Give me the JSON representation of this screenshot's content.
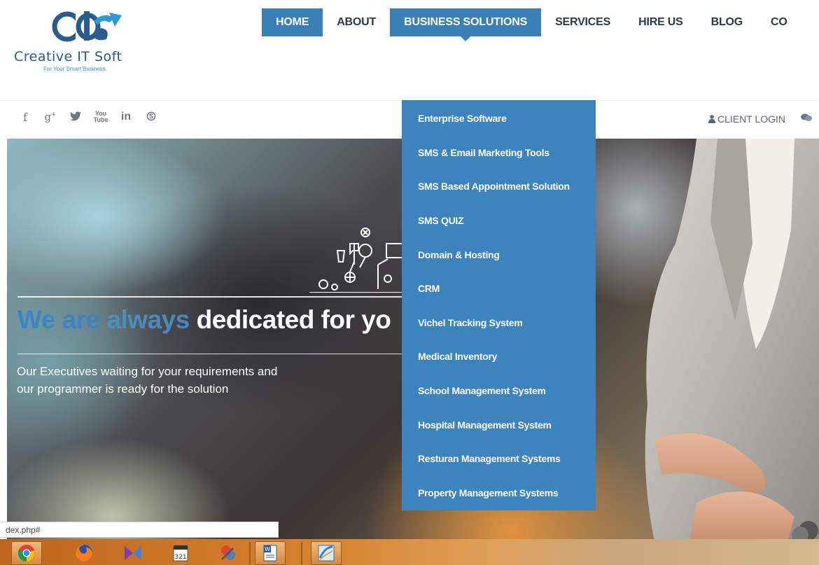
{
  "logo": {
    "name": "Creative IT Soft",
    "tagline": "For Your Smart Business"
  },
  "nav": {
    "items": [
      {
        "label": "HOME",
        "active": true
      },
      {
        "label": "ABOUT",
        "active": false
      },
      {
        "label": "BUSINESS SOLUTIONS",
        "active": true
      },
      {
        "label": "SERVICES",
        "active": false
      },
      {
        "label": "HIRE US",
        "active": false
      },
      {
        "label": "BLOG",
        "active": false
      },
      {
        "label": "CO",
        "active": false
      }
    ]
  },
  "topbar": {
    "social": [
      {
        "icon": "facebook-icon",
        "glyph": "f"
      },
      {
        "icon": "google-plus-icon",
        "glyph": "g+"
      },
      {
        "icon": "twitter-icon",
        "glyph": "t"
      },
      {
        "icon": "youtube-icon",
        "glyph": "You"
      },
      {
        "icon": "linkedin-icon",
        "glyph": "in"
      },
      {
        "icon": "skype-icon",
        "glyph": "S"
      }
    ],
    "client_login": "CLIENT LOGIN"
  },
  "dropdown": {
    "items": [
      "Enterprise Software",
      "SMS & Email Marketing Tools",
      "SMS Based Appointment Solution",
      "SMS QUIZ",
      "Domain & Hosting",
      "CRM",
      "Vichel Tracking System",
      "Medical Inventory",
      "School Management System",
      "Hospital Management System",
      "Resturan Management Systems",
      "Property Management Systems"
    ]
  },
  "hero": {
    "title_part1": "We are ",
    "title_part2": "always",
    "title_part3": " dedicated for yo",
    "subtitle_line1": "Our Executives waiting for your requirements and",
    "subtitle_line2": "our programmer is ready for the solution"
  },
  "status_bar": {
    "url": "dex.php#"
  },
  "taskbar": {
    "apps": [
      "chrome-icon",
      "firefox-icon",
      "media-player-icon",
      "calendar-icon",
      "paint-icon",
      "word-icon",
      "app-icon"
    ]
  },
  "colors": {
    "accent": "#3a7fb5",
    "dropdown_bg": "#3d83bd",
    "nav_text": "#2b3a4a"
  }
}
